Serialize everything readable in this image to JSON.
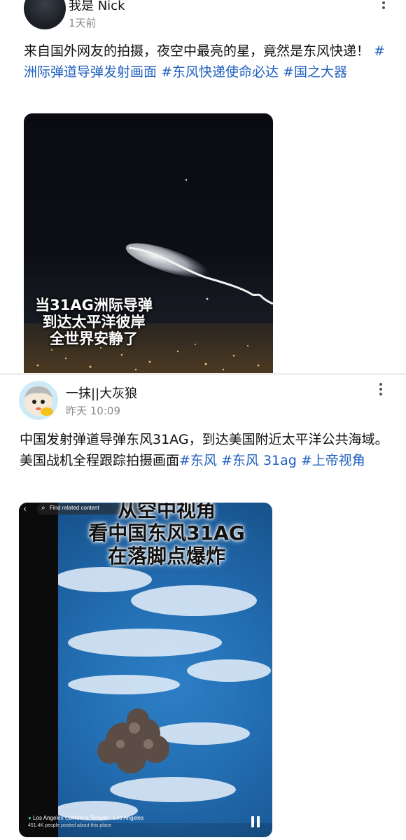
{
  "post1": {
    "author": "我是 Nick",
    "time": "1天前",
    "text_plain": "来自国外网友的拍摄，夜空中最亮的星，竟然是东风快递！ ",
    "tags": [
      "#洲际弹道导弹发射画面",
      "#东风快递使命必达",
      "#国之大器"
    ],
    "image_caption": [
      "当31AG洲际导弹",
      "到达太平洋彼岸",
      "全世界安静了"
    ]
  },
  "post2": {
    "author": "一抹||大灰狼",
    "time": "昨天 10:09",
    "text_plain": "中国发射弹道导弹东风31AG，到达美国附近太平洋公共海域。美国战机全程跟踪拍摄画面",
    "tags": [
      "#东风",
      "#东风 31ag",
      "#上帝视角"
    ],
    "image_caption": [
      "从空中视角",
      "看中国东风31AG",
      "在落脚点爆炸"
    ],
    "search_label": "Find related content",
    "location": "Los Angeles California Temple · Los Angeles",
    "location_sub": "451.4K people posted about this place"
  },
  "icons": {
    "more": "more-vertical-icon",
    "back": "back-arrow-icon",
    "search": "search-icon",
    "pause": "pause-icon",
    "location": "location-icon"
  },
  "colors": {
    "tag": "#1f5fbf",
    "divider": "#efefef"
  }
}
